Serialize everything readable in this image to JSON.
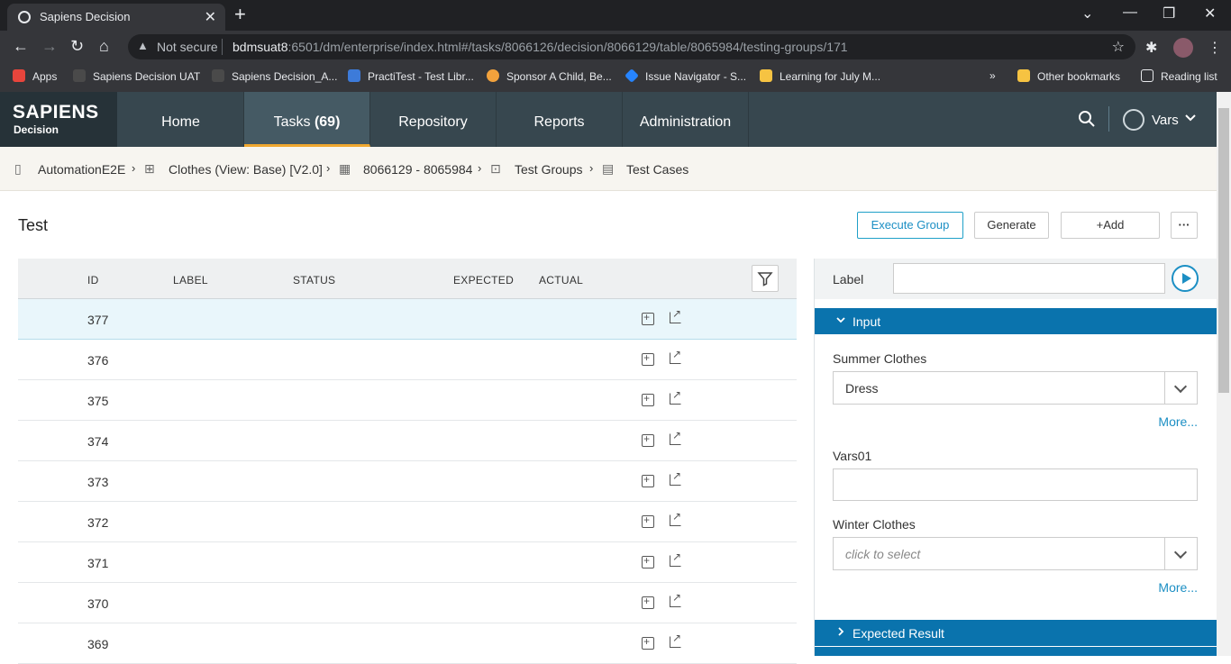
{
  "browser": {
    "tab_title": "Sapiens Decision",
    "not_secure": "Not secure",
    "url_host": "bdmsuat8",
    "url_rest": ":6501/dm/enterprise/index.html#/tasks/8066126/decision/8066129/table/8065984/testing-groups/171",
    "bookmarks": [
      {
        "label": "Apps",
        "color": "#e8453c"
      },
      {
        "label": "Sapiens Decision UAT",
        "color": "#4a4a4a"
      },
      {
        "label": "Sapiens Decision_A...",
        "color": "#4a4a4a"
      },
      {
        "label": "PractiTest - Test Libr...",
        "color": "#3d7bd9"
      },
      {
        "label": "Sponsor A Child, Be...",
        "color": "#f2a23c"
      },
      {
        "label": "Issue Navigator - S...",
        "color": "#2684ff"
      },
      {
        "label": "Learning for July M...",
        "color": "#f6c342"
      }
    ],
    "overflow": "»",
    "other_bookmarks": "Other bookmarks",
    "reading_list": "Reading list"
  },
  "app": {
    "logo_line1": "SAPIENS",
    "logo_line2": "Decision",
    "nav": [
      {
        "label": "Home"
      },
      {
        "label": "Tasks",
        "count": "(69)"
      },
      {
        "label": "Repository"
      },
      {
        "label": "Reports"
      },
      {
        "label": "Administration"
      }
    ],
    "user": "Vars"
  },
  "breadcrumb": [
    "AutomationE2E",
    "Clothes (View: Base) [V2.0]",
    "8066129 - 8065984",
    "Test Groups",
    "Test Cases"
  ],
  "page": {
    "title": "Test",
    "buttons": {
      "execute": "Execute Group",
      "generate": "Generate",
      "add": "+Add",
      "more": "···"
    }
  },
  "table": {
    "columns": [
      "ID",
      "LABEL",
      "STATUS",
      "EXPECTED",
      "ACTUAL"
    ],
    "rows": [
      "377",
      "376",
      "375",
      "374",
      "373",
      "372",
      "371",
      "370",
      "369"
    ]
  },
  "panel": {
    "label": "Label",
    "input_section": "Input",
    "fields": {
      "summer_label": "Summer Clothes",
      "summer_value": "Dress",
      "more1": "More...",
      "vars_label": "Vars01",
      "winter_label": "Winter Clothes",
      "winter_placeholder": "click to select",
      "more2": "More..."
    },
    "expected_section": "Expected Result"
  }
}
